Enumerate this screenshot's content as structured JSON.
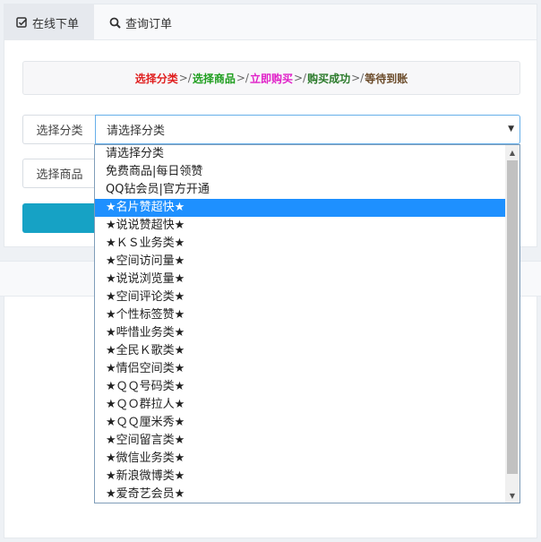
{
  "tabs": [
    {
      "label": "在线下单",
      "icon": "check-square-icon"
    },
    {
      "label": "查询订单",
      "icon": "search-icon"
    }
  ],
  "steps": [
    {
      "label": "选择分类",
      "color": "#e02020"
    },
    {
      "label": "选择商品",
      "color": "#1e9e1e"
    },
    {
      "label": "立即购买",
      "color": "#e020c8"
    },
    {
      "label": "购买成功",
      "color": "#2a7a2a"
    },
    {
      "label": "等待到账",
      "color": "#6b4b2a"
    }
  ],
  "step_separator": ">/",
  "form": {
    "category_label": "选择分类",
    "category_value": "请选择分类",
    "product_label": "选择商品"
  },
  "dropdown": {
    "selected_index": 3,
    "options": [
      "请选择分类",
      "免费商品|每日领赞",
      "QQ钻会员|官方开通",
      "★名片赞超快★",
      "★说说赞超快★",
      "★ＫＳ业务类★",
      "★空间访问量★",
      "★说说浏览量★",
      "★空间评论类★",
      "★个性标签赞★",
      "★哔惜业务类★",
      "★全民Ｋ歌类★",
      "★情侣空间类★",
      "★ＱＱ号码类★",
      "★ＱＯ群拉人★",
      "★ＱＱ厘米秀★",
      "★空间留言类★",
      "★微信业务类★",
      "★新浪微博类★",
      "★爱奇艺会员★"
    ]
  },
  "colors": {
    "accent": "#16a2c5",
    "selected": "#1e90ff",
    "focus_border": "#66afe9"
  }
}
